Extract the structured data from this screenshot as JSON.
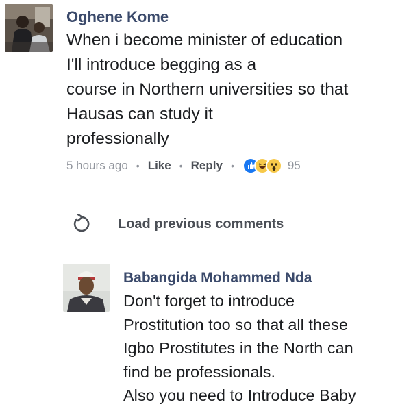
{
  "comment": {
    "author": "Oghene Kome",
    "lines": [
      "When i become minister of education",
      "I'll introduce begging as a",
      "course in Northern universities so that",
      "Hausas can study it",
      "professionally"
    ],
    "timestamp": "5 hours ago",
    "like_label": "Like",
    "reply_label": "Reply",
    "reaction_icons": [
      "like-icon",
      "haha-icon",
      "wow-icon"
    ],
    "reaction_count": "95"
  },
  "load_previous": {
    "label": "Load previous comments",
    "icon": "refresh-icon"
  },
  "reply": {
    "author": "Babangida Mohammed Nda",
    "lines": [
      "Don't forget to introduce",
      "Prostitution too so that all these",
      "Igbo Prostitutes in the North can",
      "find be professionals.",
      "Also you need to Introduce Baby"
    ]
  },
  "colors": {
    "author": "#3b4a6b",
    "meta": "#90949c",
    "like_blue": "#1877f2",
    "emoji_yellow": "#f7c94a"
  }
}
